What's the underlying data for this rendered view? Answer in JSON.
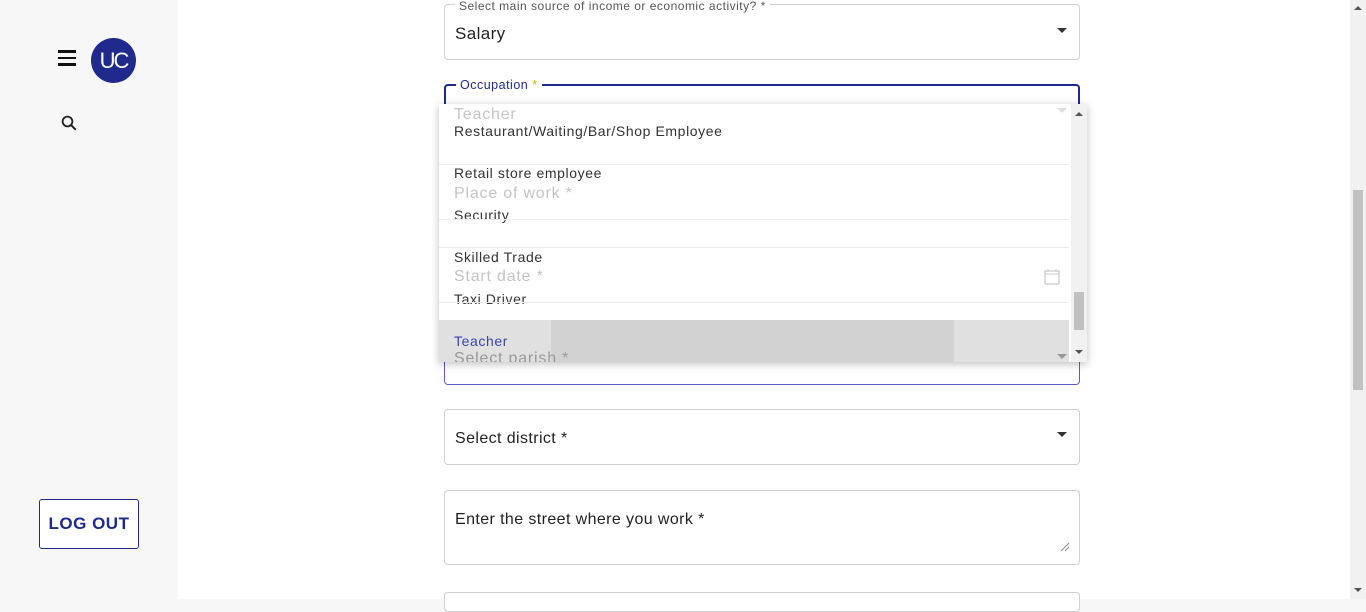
{
  "sidebar": {
    "avatar_initials": "UC",
    "logout_label": "LOG OUT",
    "menu_icon": "hamburger-menu-icon",
    "search_icon": "search-icon"
  },
  "form": {
    "income_source": {
      "label": "Select main source of income or economic activity? *",
      "value": "Salary"
    },
    "occupation": {
      "label": "Occupation",
      "required_mark": "*",
      "value": "Teacher"
    },
    "place_of_work": {
      "placeholder": "Place of work *"
    },
    "start_date": {
      "placeholder": "Start date *"
    },
    "parish": {
      "placeholder": "Select parish *"
    },
    "district": {
      "placeholder": "Select district *"
    },
    "street": {
      "placeholder": "Enter the street where you work *"
    }
  },
  "dropdown": {
    "options": [
      "Restaurant/Waiting/Bar/Shop Employee",
      "Retail store employee",
      "Security",
      "Skilled Trade",
      "Taxi Driver",
      "Teacher"
    ],
    "selected": "Teacher"
  },
  "colors": {
    "accent": "#1f2a8c",
    "required": "#e0a800"
  }
}
